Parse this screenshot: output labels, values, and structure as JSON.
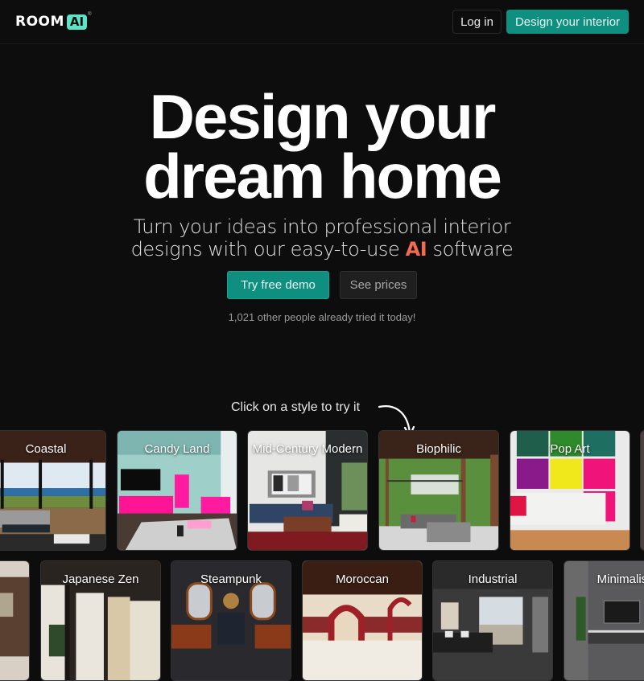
{
  "nav": {
    "logo_text": "ROOM",
    "logo_badge": "AI",
    "logo_reg": "®",
    "login_label": "Log in",
    "cta_label": "Design your interior"
  },
  "hero": {
    "title_line1": "Design your",
    "title_line2": "dream home",
    "subtitle_line1": "Turn your ideas into professional interior",
    "subtitle_line2_pre": "designs with our easy-to-use ",
    "subtitle_highlight": "AI",
    "subtitle_line2_post": " software",
    "primary_button": "Try free demo",
    "secondary_button": "See prices",
    "social_proof": "1,021 other people already tried it today!"
  },
  "styles": {
    "hint": "Click on a style to try it",
    "row1": [
      {
        "label": "Coastal"
      },
      {
        "label": "Candy Land"
      },
      {
        "label": "Mid-Century Modern"
      },
      {
        "label": "Biophilic"
      },
      {
        "label": "Pop Art"
      },
      {
        "label": ""
      }
    ],
    "row2": [
      {
        "label": ""
      },
      {
        "label": "Japanese Zen"
      },
      {
        "label": "Steampunk"
      },
      {
        "label": "Moroccan"
      },
      {
        "label": "Industrial"
      },
      {
        "label": "Minimalist"
      }
    ]
  },
  "colors": {
    "background": "#0d0d0d",
    "accent": "#0e8f80",
    "logo_badge": "#5de4c7",
    "highlight": "#f06b50"
  }
}
